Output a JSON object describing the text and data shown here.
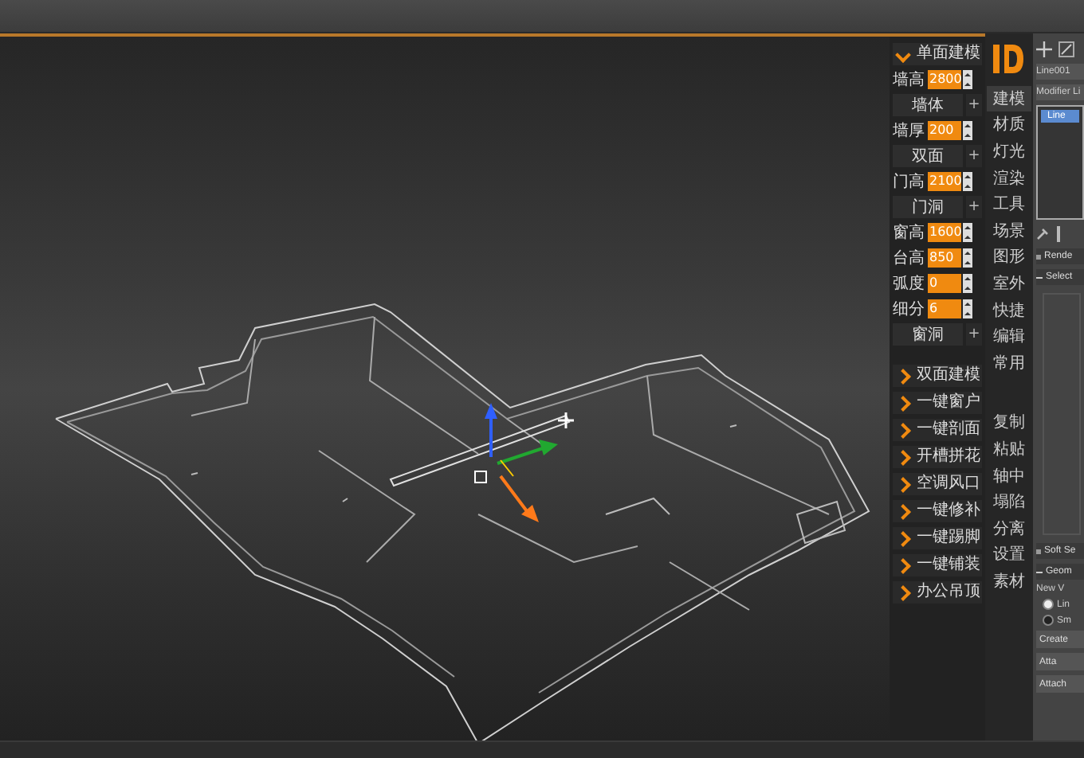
{
  "script_panel": {
    "header": {
      "label": "单面建模",
      "expanded": true
    },
    "controls": [
      {
        "kind": "spinner",
        "label": "墙高",
        "value": "2800"
      },
      {
        "kind": "button",
        "label": "墙体",
        "add": "+"
      },
      {
        "kind": "spinner",
        "label": "墙厚",
        "value": "200"
      },
      {
        "kind": "button",
        "label": "双面",
        "add": "+"
      },
      {
        "kind": "spinner",
        "label": "门高",
        "value": "2100"
      },
      {
        "kind": "button",
        "label": "门洞",
        "add": "+"
      },
      {
        "kind": "spinner",
        "label": "窗高",
        "value": "1600"
      },
      {
        "kind": "spinner",
        "label": "台高",
        "value": "850"
      },
      {
        "kind": "spinner",
        "label": "弧度",
        "value": "0"
      },
      {
        "kind": "spinner",
        "label": "细分",
        "value": "6"
      },
      {
        "kind": "button",
        "label": "窗洞",
        "add": "+"
      }
    ],
    "sections": [
      {
        "label": "双面建模",
        "expanded": false
      },
      {
        "label": "一键窗户",
        "expanded": false
      },
      {
        "label": "一键剖面",
        "expanded": false
      },
      {
        "label": "开槽拼花",
        "expanded": false
      },
      {
        "label": "空调风口",
        "expanded": false
      },
      {
        "label": "一键修补",
        "expanded": false
      },
      {
        "label": "一键踢脚",
        "expanded": false
      },
      {
        "label": "一键铺装",
        "expanded": false
      },
      {
        "label": "办公吊顶",
        "expanded": false
      }
    ]
  },
  "side_tabs": [
    {
      "label": "建模",
      "selected": true
    },
    {
      "label": "材质",
      "selected": false
    },
    {
      "label": "灯光",
      "selected": false
    },
    {
      "label": "渲染",
      "selected": false
    },
    {
      "label": "工具",
      "selected": false
    },
    {
      "label": "场景",
      "selected": false
    },
    {
      "label": "图形",
      "selected": false
    },
    {
      "label": "室外",
      "selected": false
    },
    {
      "label": "快捷",
      "selected": false
    },
    {
      "label": "编辑",
      "selected": false
    },
    {
      "label": "常用",
      "selected": false
    }
  ],
  "side_actions": [
    "复制",
    "粘贴",
    "轴中",
    "塌陷",
    "分离",
    "设置",
    "素材"
  ],
  "command_panel": {
    "object_name": "Line001",
    "modifier_list": "Modifier Li",
    "stack": [
      {
        "label": "Line",
        "selected": true
      }
    ],
    "rollouts_top": [
      {
        "label": "Rende",
        "expanded": false
      },
      {
        "label": "Select",
        "expanded": true
      }
    ],
    "rollouts_bottom": [
      {
        "label": "Soft Se",
        "expanded": false
      },
      {
        "label": "Geom",
        "expanded": true
      }
    ],
    "new_vertex_type": "New V",
    "radios": [
      {
        "label": "Lin",
        "selected": true
      },
      {
        "label": "Sm",
        "selected": false
      }
    ],
    "buttons": [
      "Create",
      "Atta",
      "Attach"
    ]
  }
}
